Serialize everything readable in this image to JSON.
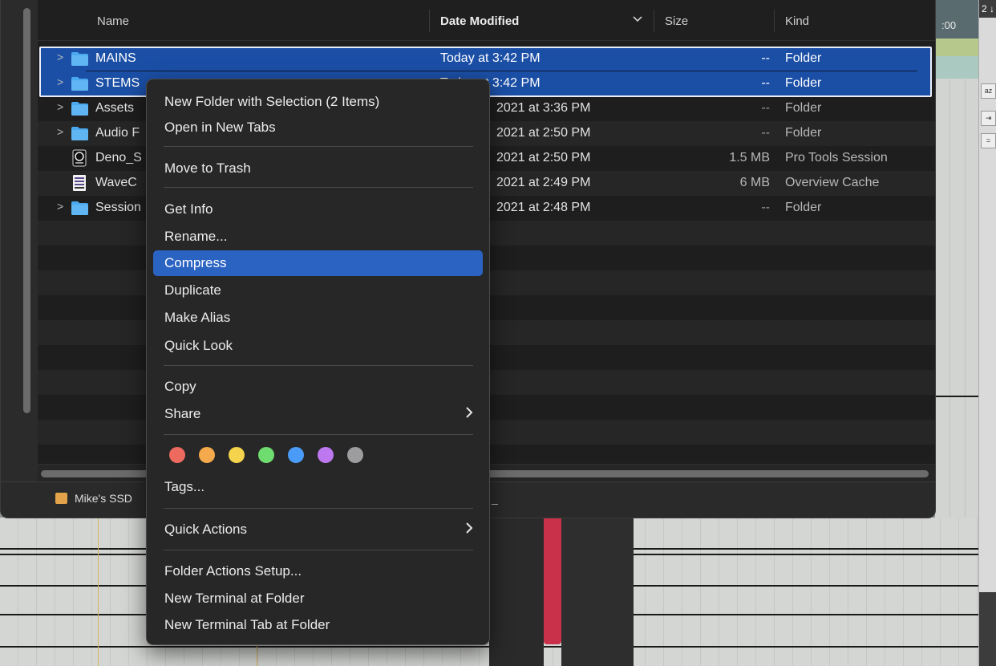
{
  "finder": {
    "columns": {
      "name": "Name",
      "date_modified": "Date Modified",
      "sort_indicator": "chevron-down",
      "size": "Size",
      "kind": "Kind"
    },
    "rows": [
      {
        "name": "MAINS",
        "date": "Today at 3:42 PM",
        "size": "--",
        "kind": "Folder",
        "icon": "folder",
        "expandable": true,
        "selected": true
      },
      {
        "name": "STEMS",
        "date": "Today at 3:42 PM",
        "size": "--",
        "kind": "Folder",
        "icon": "folder",
        "expandable": true,
        "selected": true
      },
      {
        "name": "Assets",
        "date": "2021 at 3:36 PM",
        "size": "--",
        "kind": "Folder",
        "icon": "folder",
        "expandable": true
      },
      {
        "name": "Audio F",
        "date": "2021 at 2:50 PM",
        "size": "--",
        "kind": "Folder",
        "icon": "folder",
        "expandable": true
      },
      {
        "name": "Deno_S",
        "date": "2021 at 2:50 PM",
        "size": "1.5 MB",
        "kind": "Pro Tools Session",
        "icon": "pro-tools-session"
      },
      {
        "name": "WaveC",
        "date": "2021 at 2:49 PM",
        "size": "6 MB",
        "kind": "Overview Cache",
        "icon": "overview-cache"
      },
      {
        "name": "Session",
        "date": "2021 at 2:48 PM",
        "size": "--",
        "kind": "Folder",
        "icon": "folder",
        "expandable": true
      }
    ],
    "pathbar": {
      "drive_label": "Mike's SSD",
      "trail": "_"
    }
  },
  "context_menu": {
    "items": {
      "new_folder_with_selection": "New Folder with Selection (2 Items)",
      "open_in_new_tabs": "Open in New Tabs",
      "move_to_trash": "Move to Trash",
      "get_info": "Get Info",
      "rename": "Rename...",
      "compress": "Compress",
      "duplicate": "Duplicate",
      "make_alias": "Make Alias",
      "quick_look": "Quick Look",
      "copy": "Copy",
      "share": "Share",
      "tags": "Tags...",
      "quick_actions": "Quick Actions",
      "folder_actions_setup": "Folder Actions Setup...",
      "new_terminal_at_folder": "New Terminal at Folder",
      "new_terminal_tab_at_folder": "New Terminal Tab at Folder"
    },
    "highlighted_item": "Compress",
    "tag_colors": [
      "#ec6a5e",
      "#f4a94c",
      "#f5d34d",
      "#6fdc6f",
      "#4a9bf7",
      "#bd78f0",
      "#9d9d9f"
    ]
  },
  "background_app": {
    "timecode_fragment": ":00",
    "top_right_glyph": "2 ↓"
  },
  "colors": {
    "selection_blue": "#1b4fa6",
    "menu_highlight": "#2a63c2",
    "folder_blue": "#4aa8ee"
  }
}
